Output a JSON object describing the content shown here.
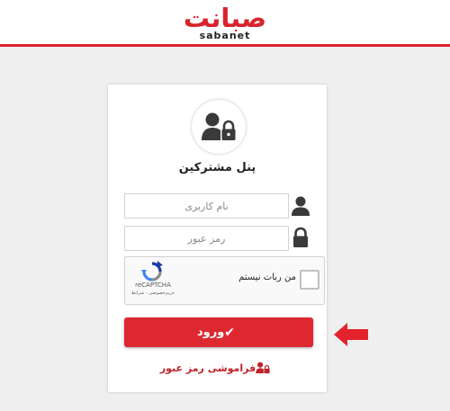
{
  "header": {
    "logo_text": "صبانت",
    "logo_subtext": "sabanet"
  },
  "login": {
    "title": "پنل مشترکین",
    "username_placeholder": "نام کاربری",
    "password_placeholder": "رمز عبور",
    "submit_label": "ورود",
    "forgot_label": "فراموشی رمز عبور"
  },
  "recaptcha": {
    "checkbox_label": "من ربات نیستم",
    "brand": "reCAPTCHA",
    "terms": "حریم‌خصوصی - شرایط"
  },
  "icons": {
    "avatar": "user-lock-icon",
    "username": "user-icon",
    "password": "lock-icon",
    "submit": "check-icon",
    "forgot": "user-lock-icon",
    "pointer": "arrow-left-icon"
  },
  "colors": {
    "brand_red": "#d9232d",
    "button_red": "#dd2830",
    "icon_gray": "#3a3a3a"
  }
}
